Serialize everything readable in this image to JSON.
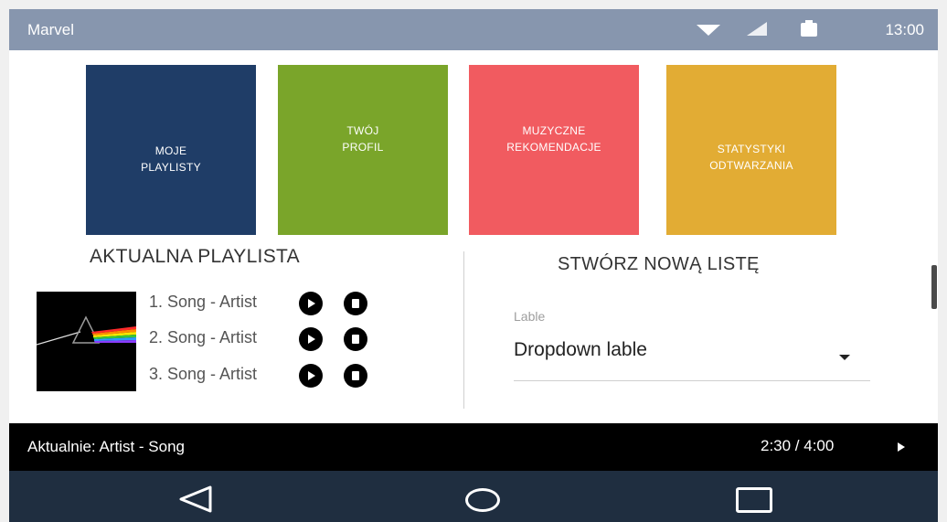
{
  "status_bar": {
    "app_name": "Marvel",
    "time": "13:00",
    "icons": [
      "wifi-icon",
      "signal-icon",
      "battery-icon"
    ]
  },
  "tiles": [
    {
      "label": "MOJE\nPLAYLISTY",
      "color": "#1f3d67"
    },
    {
      "label": "TWÓJ\nPROFIL",
      "color": "#7aa52a"
    },
    {
      "label": "MUZYCZNE\nREKOMENDACJE",
      "color": "#f15b60"
    },
    {
      "label": "STATYSTYKI\nODTWARZANIA",
      "color": "#e2ac34"
    }
  ],
  "current_playlist": {
    "title": "AKTUALNA PLAYLISTA",
    "album_art_icon": "prism-album-icon",
    "songs": [
      {
        "label": "1. Song - Artist"
      },
      {
        "label": "2. Song - Artist"
      },
      {
        "label": "3. Song - Artist"
      }
    ],
    "song_controls": [
      "play-icon",
      "stop-icon"
    ]
  },
  "new_list": {
    "title": "STWÓRZ NOWĄ LISTĘ",
    "dropdown": {
      "label": "Lable",
      "value": "Dropdown lable"
    }
  },
  "now_playing": {
    "text": "Aktualnie: Artist - Song",
    "time": "2:30 / 4:00",
    "icon": "play-icon"
  },
  "nav_bar": {
    "icons": [
      "back-icon",
      "home-icon",
      "recents-icon"
    ]
  }
}
